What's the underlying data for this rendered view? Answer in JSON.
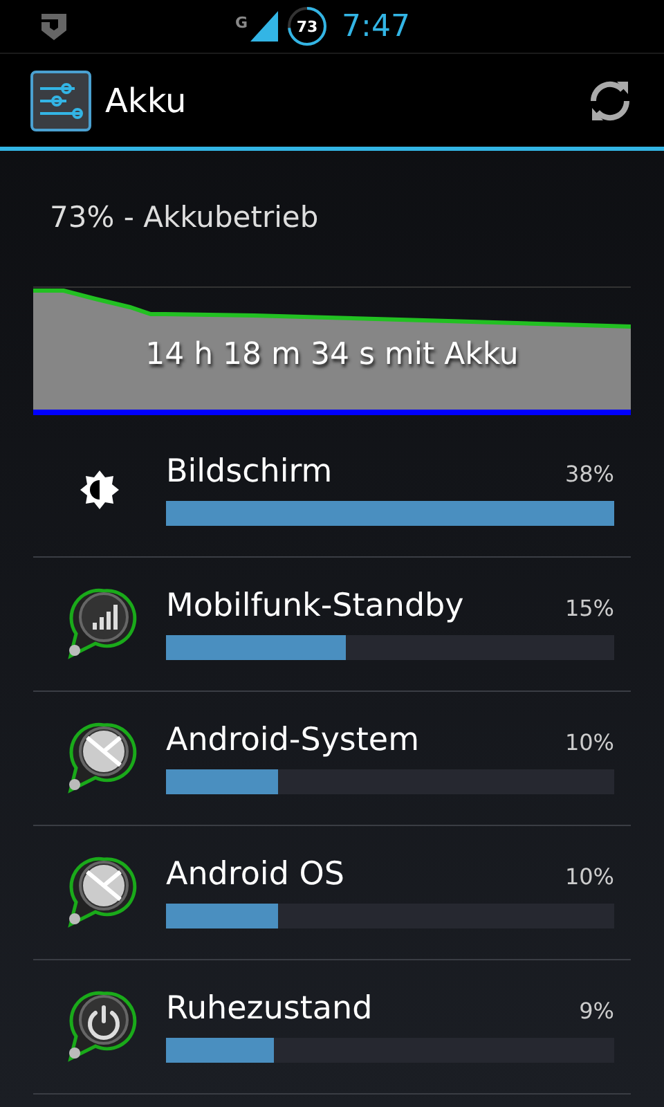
{
  "status_bar": {
    "network_type": "G",
    "battery_percent": "73",
    "time": "7:47"
  },
  "action_bar": {
    "title": "Akku"
  },
  "summary": "73% - Akkubetrieb",
  "graph": {
    "caption": "14 h 18 m 34 s mit Akku"
  },
  "usage": [
    {
      "kind": "brightness",
      "name": "Bildschirm",
      "percent": "38%",
      "level": 1.0
    },
    {
      "kind": "signal",
      "name": "Mobilfunk-Standby",
      "percent": "15%",
      "level": 0.4
    },
    {
      "kind": "metal",
      "name": "Android-System",
      "percent": "10%",
      "level": 0.25
    },
    {
      "kind": "metal",
      "name": "Android OS",
      "percent": "10%",
      "level": 0.25
    },
    {
      "kind": "power",
      "name": "Ruhezustand",
      "percent": "9%",
      "level": 0.24
    }
  ]
}
